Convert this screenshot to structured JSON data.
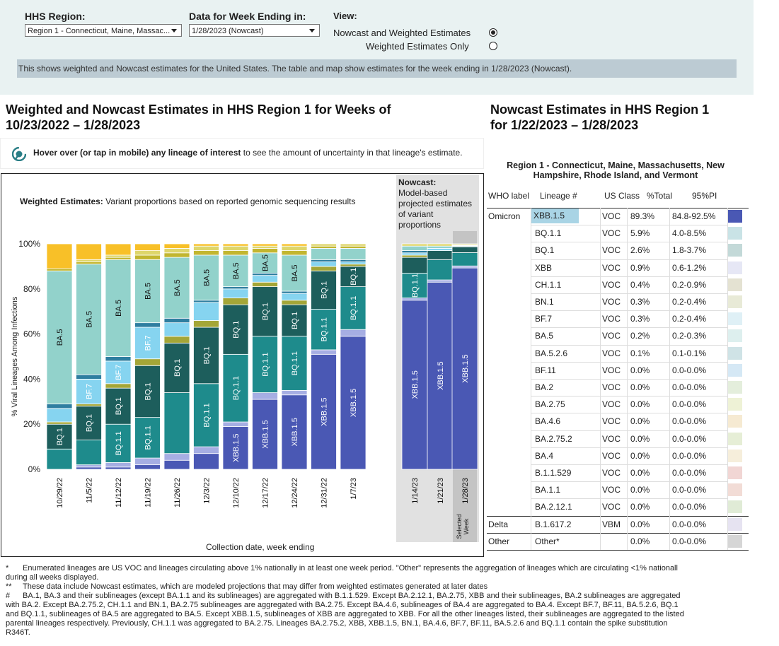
{
  "controls": {
    "region_label": "HHS Region:",
    "region_value": "Region 1 - Connecticut, Maine, Massac...",
    "week_label": "Data for Week Ending in:",
    "week_value": "1/28/2023 (Nowcast)",
    "view_label": "View:",
    "view_options": [
      {
        "label": "Nowcast and Weighted Estimates",
        "selected": true
      },
      {
        "label": "Weighted Estimates Only",
        "selected": false
      }
    ],
    "info": "This shows weighted and Nowcast estimates for the United States. The table and map show estimates for the week ending in 1/28/2023 (Nowcast)."
  },
  "left_title": {
    "line1": "Weighted and Nowcast Estimates in HHS Region 1 for Weeks of",
    "line2": "10/23/2022 – 1/28/2023"
  },
  "right_title": {
    "line1": "Nowcast Estimates in HHS Region 1",
    "line2": "for 1/22/2023 – 1/28/2023"
  },
  "hover": {
    "bold": "Hover over (or tap in mobile) any lineage of interest",
    "rest": " to see the amount of uncertainty in that lineage's estimate."
  },
  "chart_data": {
    "type": "bar",
    "stacked": true,
    "title_bold": "Weighted Estimates:",
    "title_rest": "Variant proportions based on reported genomic sequencing results",
    "nowcast_title": "Nowcast:",
    "nowcast_sub": [
      "Model-based",
      "projected estimates",
      "of variant",
      "proportions"
    ],
    "ylabel": "% Viral Lineages Among Infections",
    "xlabel": "Collection date, week ending",
    "ylim": [
      0,
      100
    ],
    "yticks": [
      "0%",
      "20%",
      "40%",
      "60%",
      "80%",
      "100%"
    ],
    "selected_note": [
      "Selected",
      "Week"
    ],
    "lineage_order": [
      "XBB.1.5",
      "XBB",
      "BQ.1.1",
      "BQ.1",
      "BA.2.75",
      "BF.7",
      "BA.5.2.6",
      "BA.5",
      "BN.1",
      "CH.1.1",
      "Other"
    ],
    "colors": {
      "XBB.1.5": "#4a58b4",
      "XBB": "#a6aee3",
      "BQ.1.1": "#1e8b8c",
      "BQ.1": "#1d5e5c",
      "BA.2.75": "#a4a637",
      "BF.7": "#86d4f0",
      "BA.5.2.6": "#2e7ea0",
      "BA.5": "#92d2cb",
      "BN.1": "#c2b630",
      "CH.1.1": "#ded66b",
      "Other": "#f8c028"
    },
    "weighted": [
      {
        "date": "10/29/22",
        "values": {
          "XBB.1.5": 0,
          "XBB": 0,
          "BQ.1.1": 9,
          "BQ.1": 11,
          "BA.2.75": 1,
          "BF.7": 6,
          "BA.5.2.6": 2,
          "BA.5": 59,
          "BN.1": 1,
          "CH.1.1": 0,
          "Other": 11
        },
        "labels": [
          "BQ.1",
          "BA.5"
        ]
      },
      {
        "date": "11/5/22",
        "values": {
          "XBB.1.5": 1,
          "XBB": 1,
          "BQ.1.1": 11,
          "BQ.1": 15,
          "BA.2.75": 1,
          "BF.7": 11,
          "BA.5.2.6": 2,
          "BA.5": 49,
          "BN.1": 1,
          "CH.1.1": 1,
          "Other": 7
        },
        "labels": [
          "BQ.1",
          "BF.7",
          "BA.5"
        ]
      },
      {
        "date": "11/12/22",
        "values": {
          "XBB.1.5": 1,
          "XBB": 2,
          "BQ.1.1": 17,
          "BQ.1": 16,
          "BA.2.75": 2,
          "BF.7": 10,
          "BA.5.2.6": 2,
          "BA.5": 43,
          "BN.1": 1,
          "CH.1.1": 1,
          "Other": 5
        },
        "labels": [
          "BQ.1.1",
          "BQ.1",
          "BF.7",
          "BA.5"
        ]
      },
      {
        "date": "11/19/22",
        "values": {
          "XBB.1.5": 2,
          "XBB": 3,
          "BQ.1.1": 18,
          "BQ.1": 23,
          "BA.2.75": 3,
          "BF.7": 14,
          "BA.5.2.6": 2,
          "BA.5": 28,
          "BN.1": 2,
          "CH.1.1": 2,
          "Other": 3
        },
        "labels": [
          "BQ.1.1",
          "BQ.1",
          "BF.7",
          "BA.5"
        ]
      },
      {
        "date": "11/26/22",
        "values": {
          "XBB.1.5": 4,
          "XBB": 3,
          "BQ.1.1": 27,
          "BQ.1": 22,
          "BA.2.75": 3,
          "BF.7": 6,
          "BA.5.2.6": 2,
          "BA.5": 27,
          "BN.1": 2,
          "CH.1.1": 2,
          "Other": 2
        },
        "labels": [
          "BQ.1",
          "BA.5"
        ]
      },
      {
        "date": "12/3/22",
        "values": {
          "XBB.1.5": 7,
          "XBB": 3,
          "BQ.1.1": 28,
          "BQ.1": 25,
          "BA.2.75": 3,
          "BF.7": 8,
          "BA.5.2.6": 1,
          "BA.5": 20,
          "BN.1": 2,
          "CH.1.1": 2,
          "Other": 1
        },
        "labels": [
          "BQ.1.1",
          "BQ.1",
          "BA.5"
        ]
      },
      {
        "date": "12/10/22",
        "values": {
          "XBB.1.5": 19,
          "XBB": 2,
          "BQ.1.1": 30,
          "BQ.1": 22,
          "BA.2.75": 3,
          "BF.7": 4,
          "BA.5.2.6": 1,
          "BA.5": 14,
          "BN.1": 2,
          "CH.1.1": 2,
          "Other": 1
        },
        "labels": [
          "XBB.1.5",
          "BQ.1.1",
          "BQ.1",
          "BA.5"
        ]
      },
      {
        "date": "12/17/22",
        "values": {
          "XBB.1.5": 31,
          "XBB": 3,
          "BQ.1.1": 25,
          "BQ.1": 22,
          "BA.2.75": 2,
          "BF.7": 3,
          "BA.5.2.6": 1,
          "BA.5": 9,
          "BN.1": 2,
          "CH.1.1": 1,
          "Other": 1
        },
        "labels": [
          "XBB.1.5",
          "BQ.1.1",
          "BQ.1",
          "BA.5"
        ]
      },
      {
        "date": "12/24/22",
        "values": {
          "XBB.1.5": 33,
          "XBB": 2,
          "BQ.1.1": 24,
          "BQ.1": 14,
          "BA.2.75": 2,
          "BF.7": 3,
          "BA.5.2.6": 1,
          "BA.5": 16,
          "BN.1": 2,
          "CH.1.1": 2,
          "Other": 1
        },
        "labels": [
          "XBB.1.5",
          "BQ.1.1",
          "BQ.1",
          "BA.5"
        ]
      },
      {
        "date": "12/31/22",
        "values": {
          "XBB.1.5": 51,
          "XBB": 2,
          "BQ.1.1": 18,
          "BQ.1": 17,
          "BA.2.75": 2,
          "BF.7": 2,
          "BA.5.2.6": 1,
          "BA.5": 5,
          "BN.1": 1,
          "CH.1.1": 1,
          "Other": 0
        },
        "labels": [
          "XBB.1.5",
          "BQ.1.1",
          "BQ.1"
        ]
      },
      {
        "date": "1/7/23",
        "values": {
          "XBB.1.5": 59,
          "XBB": 3,
          "BQ.1.1": 19,
          "BQ.1": 9,
          "BA.2.75": 1,
          "BF.7": 1,
          "BA.5.2.6": 1,
          "BA.5": 5,
          "BN.1": 1,
          "CH.1.1": 1,
          "Other": 0
        },
        "labels": [
          "XBB.1.5",
          "BQ.1.1",
          "BQ.1"
        ]
      }
    ],
    "nowcast": [
      {
        "date": "1/14/23",
        "values": {
          "XBB.1.5": 75,
          "XBB": 1,
          "BQ.1.1": 11,
          "BQ.1": 7,
          "BA.2.75": 1,
          "BF.7": 1,
          "BA.5.2.6": 1,
          "BA.5": 2,
          "BN.1": 0,
          "CH.1.1": 1,
          "Other": 0
        },
        "labels": [
          "XBB.1.5",
          "BQ.1.1"
        ]
      },
      {
        "date": "1/21/23",
        "values": {
          "XBB.1.5": 83,
          "XBB": 1,
          "BQ.1.1": 9,
          "BQ.1": 4,
          "BA.2.75": 0,
          "BF.7": 1,
          "BA.5.2.6": 0,
          "BA.5": 1,
          "BN.1": 0,
          "CH.1.1": 1,
          "Other": 0
        },
        "labels": [
          "XBB.1.5"
        ]
      },
      {
        "date": "1/28/23",
        "values": {
          "XBB.1.5": 89.3,
          "XBB": 0.9,
          "BQ.1.1": 5.9,
          "BQ.1": 2.6,
          "BA.2.75": 0,
          "BF.7": 0.3,
          "BA.5.2.6": 0.1,
          "BA.5": 0.2,
          "BN.1": 0.3,
          "CH.1.1": 0.4,
          "Other": 0
        },
        "labels": [
          "XBB.1.5"
        ]
      }
    ]
  },
  "table": {
    "title": "Region 1 - Connecticut, Maine, Massachusetts, New Hampshire, Rhode Island, and Vermont",
    "headers": [
      "WHO label",
      "Lineage #",
      "US Class",
      "%Total",
      "95%PI"
    ],
    "rows": [
      {
        "who": "Omicron",
        "lineage": "XBB.1.5",
        "cls": "VOC",
        "pct": "89.3%",
        "pi": "84.8-92.5%",
        "color": "#4a58b4"
      },
      {
        "who": "",
        "lineage": "BQ.1.1",
        "cls": "VOC",
        "pct": "5.9%",
        "pi": "4.0-8.5%",
        "color": "#c9e3e6"
      },
      {
        "who": "",
        "lineage": "BQ.1",
        "cls": "VOC",
        "pct": "2.6%",
        "pi": "1.8-3.7%",
        "color": "#c3d9d8"
      },
      {
        "who": "",
        "lineage": "XBB",
        "cls": "VOC",
        "pct": "0.9%",
        "pi": "0.6-1.2%",
        "color": "#e6e7f5"
      },
      {
        "who": "",
        "lineage": "CH.1.1",
        "cls": "VOC",
        "pct": "0.4%",
        "pi": "0.2-0.9%",
        "color": "#e4e2d2"
      },
      {
        "who": "",
        "lineage": "BN.1",
        "cls": "VOC",
        "pct": "0.3%",
        "pi": "0.2-0.4%",
        "color": "#e8ead7"
      },
      {
        "who": "",
        "lineage": "BF.7",
        "cls": "VOC",
        "pct": "0.3%",
        "pi": "0.2-0.4%",
        "color": "#dff0f6"
      },
      {
        "who": "",
        "lineage": "BA.5",
        "cls": "VOC",
        "pct": "0.2%",
        "pi": "0.2-0.3%",
        "color": "#ddefee"
      },
      {
        "who": "",
        "lineage": "BA.5.2.6",
        "cls": "VOC",
        "pct": "0.1%",
        "pi": "0.1-0.1%",
        "color": "#cfe3e6"
      },
      {
        "who": "",
        "lineage": "BF.11",
        "cls": "VOC",
        "pct": "0.0%",
        "pi": "0.0-0.0%",
        "color": "#d5e8f5"
      },
      {
        "who": "",
        "lineage": "BA.2",
        "cls": "VOC",
        "pct": "0.0%",
        "pi": "0.0-0.0%",
        "color": "#e4eedc"
      },
      {
        "who": "",
        "lineage": "BA.2.75",
        "cls": "VOC",
        "pct": "0.0%",
        "pi": "0.0-0.0%",
        "color": "#eef2d6"
      },
      {
        "who": "",
        "lineage": "BA.4.6",
        "cls": "VOC",
        "pct": "0.0%",
        "pi": "0.0-0.0%",
        "color": "#f6ead2"
      },
      {
        "who": "",
        "lineage": "BA.2.75.2",
        "cls": "VOC",
        "pct": "0.0%",
        "pi": "0.0-0.0%",
        "color": "#e6eed6"
      },
      {
        "who": "",
        "lineage": "BA.4",
        "cls": "VOC",
        "pct": "0.0%",
        "pi": "0.0-0.0%",
        "color": "#f6eedb"
      },
      {
        "who": "",
        "lineage": "B.1.1.529",
        "cls": "VOC",
        "pct": "0.0%",
        "pi": "0.0-0.0%",
        "color": "#f1d6d4"
      },
      {
        "who": "",
        "lineage": "BA.1.1",
        "cls": "VOC",
        "pct": "0.0%",
        "pi": "0.0-0.0%",
        "color": "#f2dcd6"
      },
      {
        "who": "",
        "lineage": "BA.2.12.1",
        "cls": "VOC",
        "pct": "0.0%",
        "pi": "0.0-0.0%",
        "color": "#e0ebd6"
      },
      {
        "who": "Delta",
        "lineage": "B.1.617.2",
        "cls": "VBM",
        "pct": "0.0%",
        "pi": "0.0-0.0%",
        "color": "#e6e3f1"
      },
      {
        "who": "Other",
        "lineage": "Other*",
        "cls": "",
        "pct": "0.0%",
        "pi": "0.0-0.0%",
        "color": "#d6d6d6"
      }
    ]
  },
  "footnotes": [
    {
      "mark": "*",
      "text": "Enumerated lineages are US VOC and lineages circulating above 1% nationally in at least one week period. \"Other\" represents the aggregation of lineages which are circulating <1% nationall",
      "text2": "during all weeks displayed."
    },
    {
      "mark": "**",
      "text": "These data include Nowcast estimates, which are modeled projections that may differ from weighted estimates generated at later dates",
      "text2": ""
    },
    {
      "mark": "#",
      "text": "BA.1, BA.3 and their sublineages (except BA.1.1 and its sublineages) are aggregated with B.1.1.529. Except BA.2.12.1, BA.2.75, XBB and their sublineages, BA.2 sublineages are aggregated",
      "lines": [
        "with BA.2. Except BA.2.75.2, CH.1.1 and BN.1, BA.2.75 sublineages are aggregated with BA.2.75. Except BA.4.6, sublineages of BA.4 are aggregated to BA.4. Except BF.7, BF.11, BA.5.2.6, BQ.1",
        "and BQ.1.1, sublineages of BA.5 are aggregated to BA.5. Except XBB.1.5, sublineages of XBB are aggregated to XBB. For all the other lineages listed, their sublineages are aggregated to the listed",
        "parental lineages respectively. Previously, CH.1.1 was aggregated to BA.2.75. Lineages BA.2.75.2, XBB, XBB.1.5, BN.1, BA.4.6, BF.7, BF.11, BA.5.2.6 and BQ.1.1 contain the spike substitution",
        "R346T."
      ]
    }
  ]
}
